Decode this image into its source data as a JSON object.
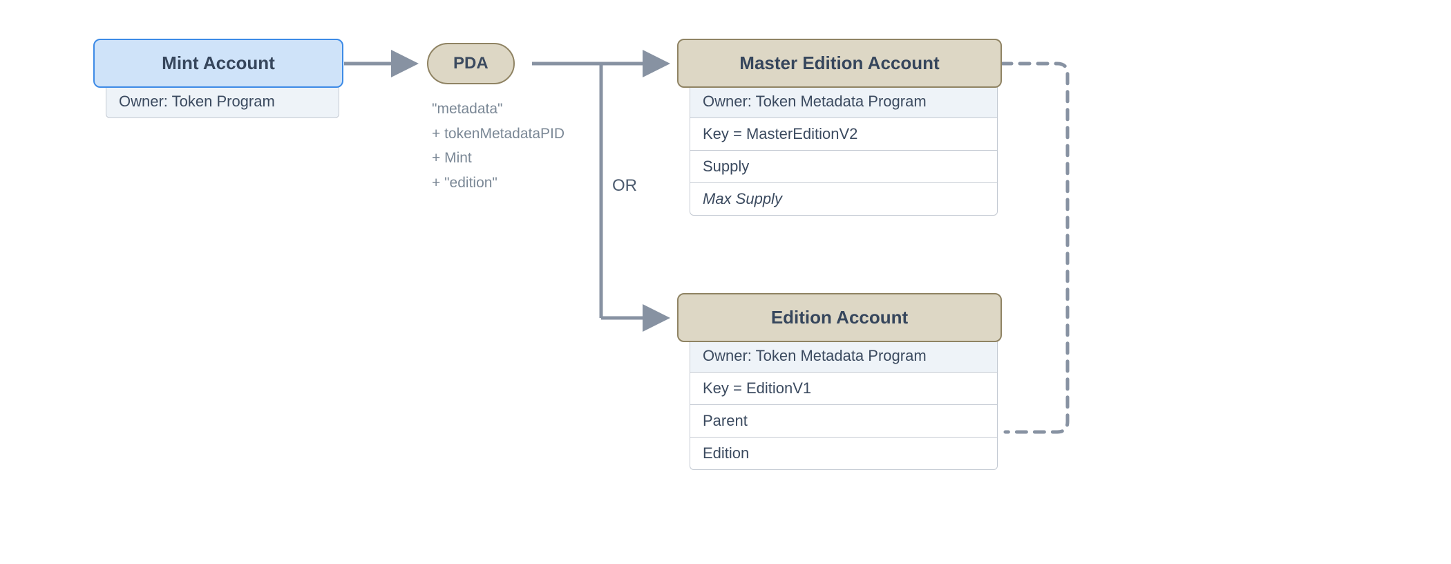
{
  "mint": {
    "title": "Mint Account",
    "owner": "Owner: Token Program"
  },
  "pda": {
    "label": "PDA",
    "seeds": {
      "s1": "\"metadata\"",
      "s2": "+ tokenMetadataPID",
      "s3": "+ Mint",
      "s4": "+ \"edition\""
    }
  },
  "branch": {
    "or": "OR"
  },
  "master": {
    "title": "Master Edition Account",
    "owner": "Owner: Token Metadata Program",
    "key": "Key = MasterEditionV2",
    "supply": "Supply",
    "maxSupply": "Max Supply"
  },
  "edition": {
    "title": "Edition Account",
    "owner": "Owner: Token Metadata Program",
    "key": "Key = EditionV1",
    "parent": "Parent",
    "edition": "Edition"
  }
}
